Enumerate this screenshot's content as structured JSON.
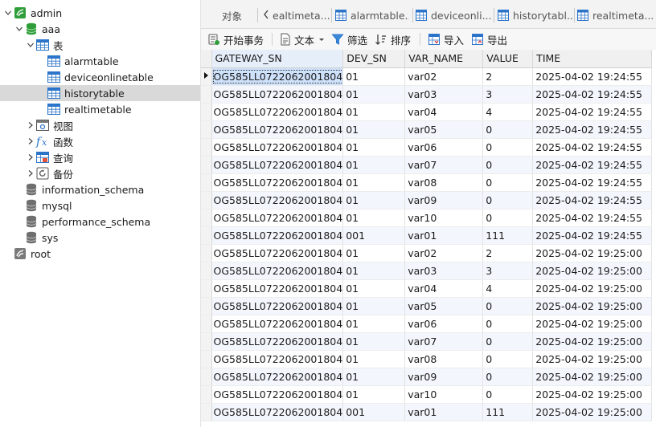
{
  "tree": {
    "nodes": [
      {
        "label": "admin",
        "icon": "connection-icon",
        "expand": "down",
        "depth": 0
      },
      {
        "label": "aaa",
        "icon": "database-icon",
        "expand": "down",
        "depth": 1
      },
      {
        "label": "表",
        "icon": "tables-folder-icon",
        "expand": "down",
        "depth": 2
      },
      {
        "label": "alarmtable",
        "icon": "table-icon",
        "expand": "",
        "depth": 3
      },
      {
        "label": "deviceonlinetable",
        "icon": "table-icon",
        "expand": "",
        "depth": 3
      },
      {
        "label": "historytable",
        "icon": "table-icon",
        "expand": "",
        "depth": 3,
        "selected": true
      },
      {
        "label": "realtimetable",
        "icon": "table-icon",
        "expand": "",
        "depth": 3
      },
      {
        "label": "视图",
        "icon": "view-icon",
        "expand": "right",
        "depth": 2
      },
      {
        "label": "函数",
        "icon": "function-icon",
        "expand": "right",
        "depth": 2
      },
      {
        "label": "查询",
        "icon": "query-icon",
        "expand": "right",
        "depth": 2
      },
      {
        "label": "备份",
        "icon": "backup-icon",
        "expand": "right",
        "depth": 2
      },
      {
        "label": "information_schema",
        "icon": "database-gray-icon",
        "expand": "",
        "depth": 1
      },
      {
        "label": "mysql",
        "icon": "database-gray-icon",
        "expand": "",
        "depth": 1
      },
      {
        "label": "performance_schema",
        "icon": "database-gray-icon",
        "expand": "",
        "depth": 1
      },
      {
        "label": "sys",
        "icon": "database-gray-icon",
        "expand": "",
        "depth": 1
      },
      {
        "label": "root",
        "icon": "connection-gray-icon",
        "expand": "",
        "depth": 0
      }
    ]
  },
  "tabs": {
    "objects": "对象",
    "items": [
      {
        "label": "ealtimeta..."
      },
      {
        "label": "alarmtable..."
      },
      {
        "label": "deviceonli..."
      },
      {
        "label": "historytabl..."
      },
      {
        "label": "realtimeta..."
      }
    ]
  },
  "toolbar": {
    "begin_transaction": "开始事务",
    "text": "文本",
    "filter": "筛选",
    "sort": "排序",
    "import": "导入",
    "export": "导出"
  },
  "grid": {
    "columns": [
      "GATEWAY_SN",
      "DEV_SN",
      "VAR_NAME",
      "VALUE",
      "TIME"
    ],
    "rows": [
      [
        "OG585LL0722062001804",
        "01",
        "var02",
        "2",
        "2025-04-02 19:24:55"
      ],
      [
        "OG585LL0722062001804",
        "01",
        "var03",
        "3",
        "2025-04-02 19:24:55"
      ],
      [
        "OG585LL0722062001804",
        "01",
        "var04",
        "4",
        "2025-04-02 19:24:55"
      ],
      [
        "OG585LL0722062001804",
        "01",
        "var05",
        "0",
        "2025-04-02 19:24:55"
      ],
      [
        "OG585LL0722062001804",
        "01",
        "var06",
        "0",
        "2025-04-02 19:24:55"
      ],
      [
        "OG585LL0722062001804",
        "01",
        "var07",
        "0",
        "2025-04-02 19:24:55"
      ],
      [
        "OG585LL0722062001804",
        "01",
        "var08",
        "0",
        "2025-04-02 19:24:55"
      ],
      [
        "OG585LL0722062001804",
        "01",
        "var09",
        "0",
        "2025-04-02 19:24:55"
      ],
      [
        "OG585LL0722062001804",
        "01",
        "var10",
        "0",
        "2025-04-02 19:24:55"
      ],
      [
        "OG585LL0722062001804",
        "001",
        "var01",
        "111",
        "2025-04-02 19:24:55"
      ],
      [
        "OG585LL0722062001804",
        "01",
        "var02",
        "2",
        "2025-04-02 19:25:00"
      ],
      [
        "OG585LL0722062001804",
        "01",
        "var03",
        "3",
        "2025-04-02 19:25:00"
      ],
      [
        "OG585LL0722062001804",
        "01",
        "var04",
        "4",
        "2025-04-02 19:25:00"
      ],
      [
        "OG585LL0722062001804",
        "01",
        "var05",
        "0",
        "2025-04-02 19:25:00"
      ],
      [
        "OG585LL0722062001804",
        "01",
        "var06",
        "0",
        "2025-04-02 19:25:00"
      ],
      [
        "OG585LL0722062001804",
        "01",
        "var07",
        "0",
        "2025-04-02 19:25:00"
      ],
      [
        "OG585LL0722062001804",
        "01",
        "var08",
        "0",
        "2025-04-02 19:25:00"
      ],
      [
        "OG585LL0722062001804",
        "01",
        "var09",
        "0",
        "2025-04-02 19:25:00"
      ],
      [
        "OG585LL0722062001804",
        "01",
        "var10",
        "0",
        "2025-04-02 19:25:00"
      ],
      [
        "OG585LL0722062001804",
        "001",
        "var01",
        "111",
        "2025-04-02 19:25:00"
      ]
    ]
  },
  "colors": {
    "accent": "#2b74c9",
    "db_green": "#2f9e3a",
    "selection": "#cfe2fb",
    "tree_selected": "#d9d9d9"
  }
}
